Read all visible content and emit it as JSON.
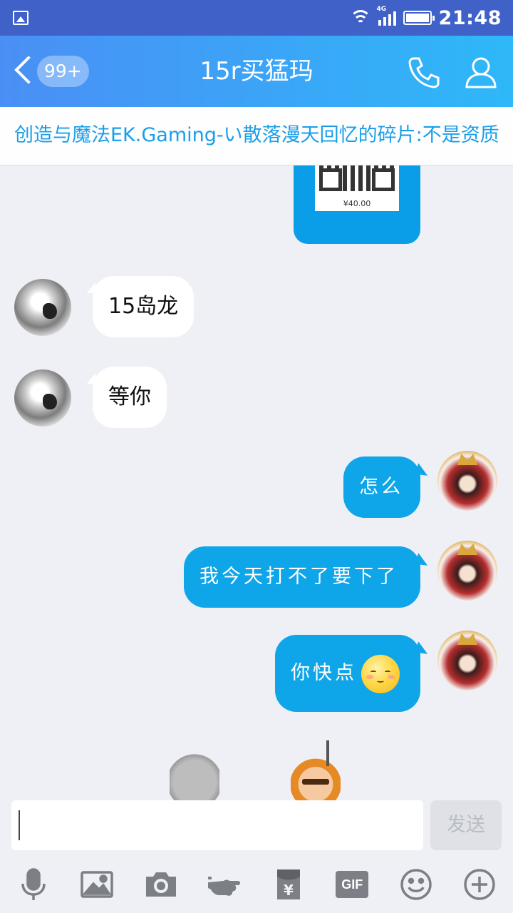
{
  "status_bar": {
    "network": "4G",
    "time": "21:48"
  },
  "header": {
    "unread_badge": "99+",
    "title": "15r买猛玛"
  },
  "notice": {
    "text": "创造与魔法EK.Gaming-い散落漫天回忆的碎片:不是资质"
  },
  "messages": [
    {
      "side": "in",
      "text": "15岛龙"
    },
    {
      "side": "in",
      "text": "等你"
    },
    {
      "side": "out",
      "text": "怎么"
    },
    {
      "side": "out",
      "text": "我今天打不了要下了"
    },
    {
      "side": "out",
      "text": "你快点"
    }
  ],
  "qr_message": {
    "price": "¥40.00"
  },
  "composer": {
    "input_value": "",
    "send_label": "发送"
  },
  "toolbar": [
    "microphone-icon",
    "image-icon",
    "camera-icon",
    "poke-icon",
    "red-packet-icon",
    "gif-icon",
    "emoji-icon",
    "plus-icon"
  ],
  "toolbar_gif_label": "GIF",
  "colors": {
    "header_start": "#4a8ff5",
    "header_end": "#2eb8f8",
    "out_bubble": "#0ea5e9",
    "notice_text": "#1a9ee8"
  }
}
